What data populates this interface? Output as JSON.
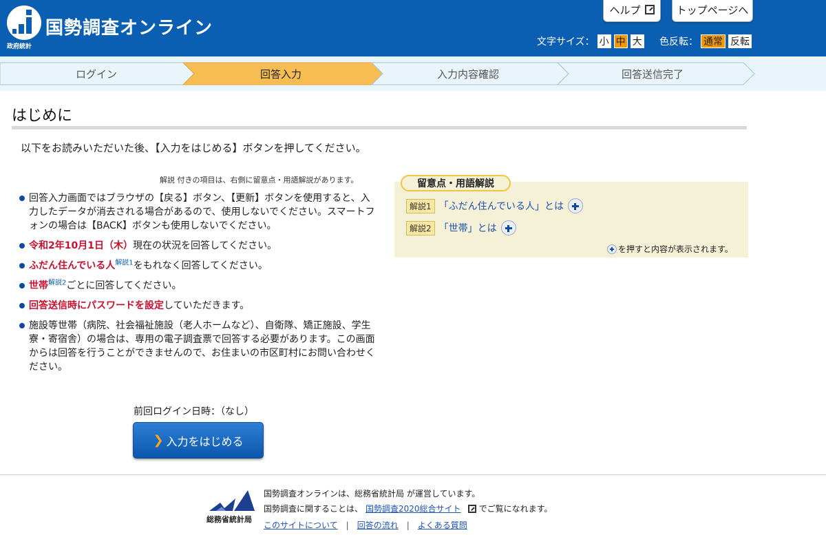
{
  "header": {
    "logo_sub": "政府統計",
    "title": "国勢調査オンライン",
    "help_label": "ヘルプ",
    "top_label": "トップページへ",
    "font_size_label": "文字サイズ：",
    "font_sizes": [
      "小",
      "中",
      "大"
    ],
    "font_size_selected": "中",
    "invert_label": "色反転：",
    "invert_options": [
      "通常",
      "反転"
    ],
    "invert_selected": "通常",
    "accent_color": "#0b5fb3",
    "highlight_color": "#f39800"
  },
  "steps": {
    "items": [
      "ログイン",
      "回答入力",
      "入力内容確認",
      "回答送信完了"
    ],
    "current": "回答入力"
  },
  "main": {
    "title": "はじめに",
    "lead": "以下をお読みいただいた後、【入力をはじめる】ボタンを押してください。",
    "note_small": "解説 付きの項目は、右側に留意点・用語解説があります。",
    "items": {
      "i1": "回答入力画面ではブラウザの【戻る】ボタン、【更新】ボタンを使用すると、入力したデータが消去される場合があるので、使用しないでください。スマートフォンの場合は【BACK】ボタンも使用しないでください。",
      "i2_red": "令和2年10月1日（木）",
      "i2_rest": "現在の状況を回答してください。",
      "i3_red": "ふだん住んでいる人",
      "i3_sup": "解説1",
      "i3_rest": "をもれなく回答してください。",
      "i4_red": "世帯",
      "i4_sup": "解説2",
      "i4_rest": "ごとに回答してください。",
      "i5_red": "回答送信時にパスワードを設定",
      "i5_rest": "していただきます。",
      "i6": "施設等世帯（病院、社会福祉施設（老人ホームなど）、自衛隊、矯正施設、学生寮・寄宿舎）の場合は、専用の電子調査票で回答する必要があります。この画面からは回答を行うことができませんので、お住まいの市区町村にお問い合わせください。"
    },
    "last_login": "前回ログイン日時：（なし）",
    "start_button": "入力をはじめる"
  },
  "glossary": {
    "title": "留意点・用語解説",
    "rows": [
      {
        "tag": "解説1",
        "text": "「ふだん住んでいる人」とは"
      },
      {
        "tag": "解説2",
        "text": "「世帯」とは"
      }
    ],
    "hint": "を押すと内容が表示されます。"
  },
  "footer": {
    "org": "総務省統計局",
    "line1": "国勢調査オンラインは、総務省統計局 が運営しています。",
    "line2_a": "国勢調査に関することは、",
    "line2_link": "国勢調査2020総合サイト",
    "line2_b": "でご覧になれます。",
    "links": [
      "このサイトについて",
      "回答の流れ",
      "よくある質問"
    ]
  }
}
